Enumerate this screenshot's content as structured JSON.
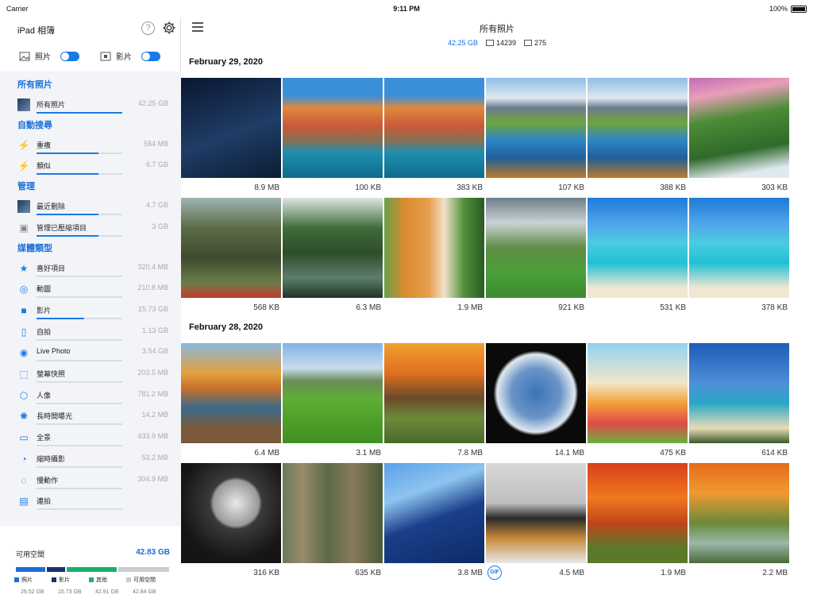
{
  "status": {
    "carrier": "Carrier",
    "time": "9:11 PM",
    "battery": "100%"
  },
  "sidebar": {
    "title": "iPad 相簿",
    "help": "?",
    "toggles": [
      {
        "label": "照片"
      },
      {
        "label": "影片"
      }
    ],
    "sections": [
      {
        "title": "所有照片",
        "items": [
          {
            "label": "所有照片",
            "value": "42.25 GB",
            "fill": 1.0,
            "icon": "photo-thumb"
          }
        ]
      },
      {
        "title": "自動搜尋",
        "items": [
          {
            "label": "重複",
            "value": "584 MB",
            "fill": 0.72,
            "icon": "flash-icon"
          },
          {
            "label": "類似",
            "value": "6.7 GB",
            "fill": 0.72,
            "icon": "flash-icon"
          }
        ]
      },
      {
        "title": "管理",
        "items": [
          {
            "label": "最近刪除",
            "value": "4.7 GB",
            "fill": 0.72,
            "icon": "photo-thumb"
          },
          {
            "label": "管理已壓縮項目",
            "value": "3 GB",
            "fill": 0.72,
            "icon": "image-icon"
          }
        ]
      },
      {
        "title": "媒體類型",
        "items": [
          {
            "label": "喜好項目",
            "value": "320.4 MB",
            "fill": 0.0,
            "icon": "star-icon"
          },
          {
            "label": "動圖",
            "value": "210.8 MB",
            "fill": 0.0,
            "icon": "gif-icon"
          },
          {
            "label": "影片",
            "value": "15.73 GB",
            "fill": 0.56,
            "icon": "video-icon"
          },
          {
            "label": "自拍",
            "value": "1.13 GB",
            "fill": 0.0,
            "icon": "selfie-icon"
          },
          {
            "label": "Live Photo",
            "value": "3.54 GB",
            "fill": 0.0,
            "icon": "live-photo-icon"
          },
          {
            "label": "螢幕快照",
            "value": "203.5 MB",
            "fill": 0.0,
            "icon": "screenshot-icon"
          },
          {
            "label": "人像",
            "value": "781.2 MB",
            "fill": 0.0,
            "icon": "portrait-icon"
          },
          {
            "label": "長時間曝光",
            "value": "14.2 MB",
            "fill": 0.0,
            "icon": "long-exposure-icon"
          },
          {
            "label": "全景",
            "value": "433.9 MB",
            "fill": 0.0,
            "icon": "panorama-icon"
          },
          {
            "label": "縮時攝影",
            "value": "53.2 MB",
            "fill": 0.0,
            "icon": "timelapse-icon"
          },
          {
            "label": "慢動作",
            "value": "304.9 MB",
            "fill": 0.0,
            "icon": "slomo-icon"
          },
          {
            "label": "連拍",
            "value": "",
            "fill": 0.0,
            "icon": "burst-icon"
          }
        ]
      }
    ],
    "storage": {
      "label": "可用空間",
      "value": "42.83 GB",
      "legend": [
        {
          "name": "照片",
          "value": "26.52 GB",
          "color": "#1a6fd8"
        },
        {
          "name": "影片",
          "value": "15.73 GB",
          "color": "#1b2f6b"
        },
        {
          "name": "其他",
          "value": "42.91 GB",
          "color": "#19b26a"
        },
        {
          "name": "可用空間",
          "value": "42.84 GB",
          "color": "#c9ccd3"
        }
      ]
    }
  },
  "main": {
    "title": "所有照片",
    "size": "42.25 GB",
    "photo_count": "14239",
    "video_count": "275",
    "days": [
      {
        "date": "February 29, 2020",
        "rows": [
          [
            {
              "size": "8.9 MB",
              "img": "night-sky"
            },
            {
              "size": "100 KB",
              "img": "cliff-village"
            },
            {
              "size": "383 KB",
              "img": "cliff-village"
            },
            {
              "size": "107 KB",
              "img": "mountain-lake"
            },
            {
              "size": "388 KB",
              "img": "mountain-lake"
            },
            {
              "size": "303 KB",
              "img": "waterfall"
            }
          ],
          [
            {
              "size": "568 KB",
              "img": "temple-gate"
            },
            {
              "size": "6.3 MB",
              "img": "stone-bridge"
            },
            {
              "size": "1.9 MB",
              "img": "tiger"
            },
            {
              "size": "921 KB",
              "img": "green-field"
            },
            {
              "size": "531 KB",
              "img": "tropical-beach"
            },
            {
              "size": "378 KB",
              "img": "tropical-beach"
            }
          ]
        ]
      },
      {
        "date": "February 28, 2020",
        "rows": [
          [
            {
              "size": "6.4 MB",
              "img": "autumn-lake"
            },
            {
              "size": "3.1 MB",
              "img": "meadow-horse"
            },
            {
              "size": "7.8 MB",
              "img": "sunset-savanna"
            },
            {
              "size": "14.1 MB",
              "img": "earth"
            },
            {
              "size": "475 KB",
              "img": "cocktails"
            },
            {
              "size": "614 KB",
              "img": "palm-beach"
            }
          ],
          [
            {
              "size": "316 KB",
              "img": "moon-tree"
            },
            {
              "size": "635 KB",
              "img": "forest-deer"
            },
            {
              "size": "3.8 MB",
              "img": "skyscraper"
            },
            {
              "size": "4.5 MB",
              "img": "shiba-dogs",
              "gif": "GIF"
            },
            {
              "size": "1.9 MB",
              "img": "autumn-trees"
            },
            {
              "size": "2.2 MB",
              "img": "autumn-stream"
            }
          ]
        ]
      }
    ]
  }
}
